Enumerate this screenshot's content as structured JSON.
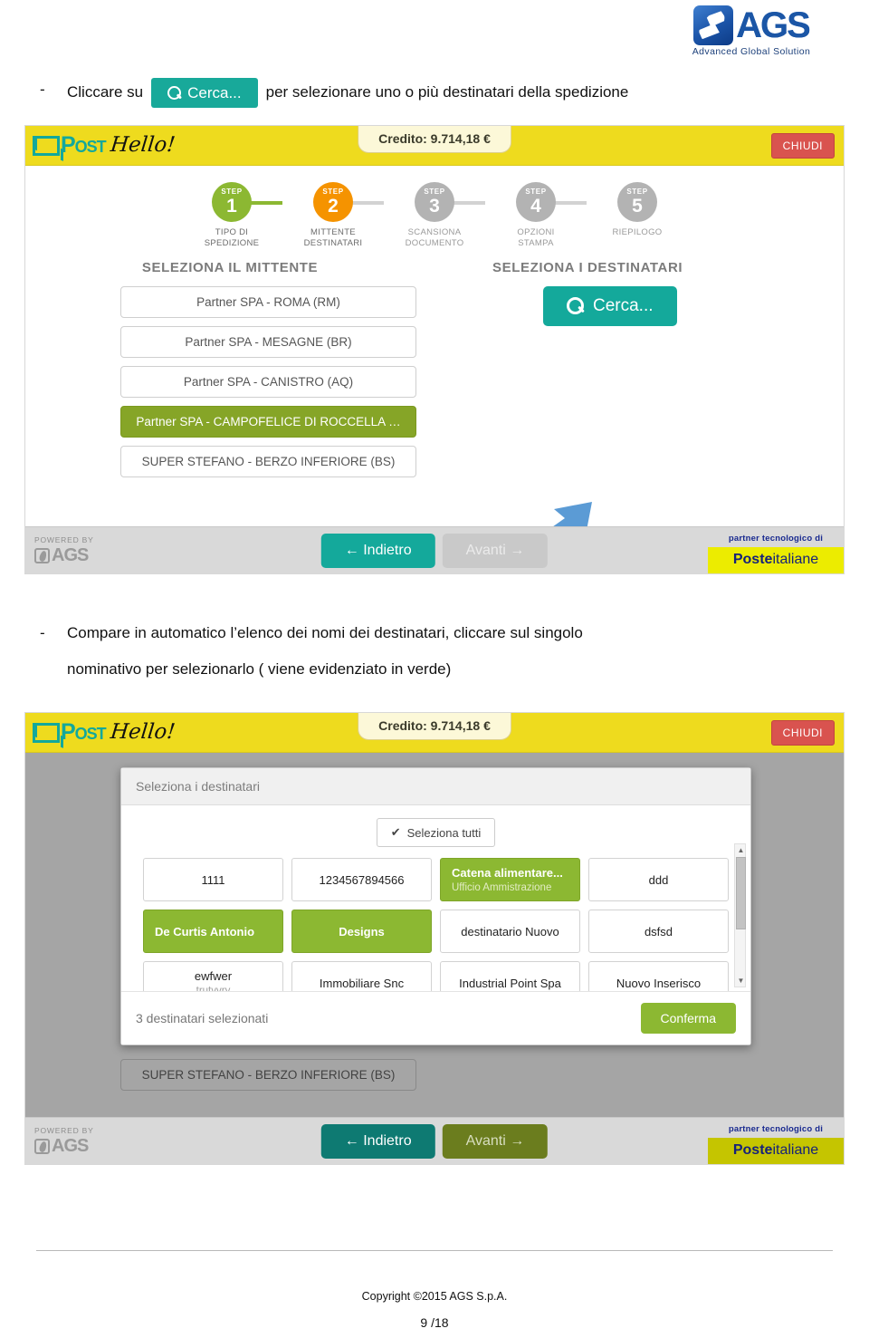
{
  "brand": {
    "ags_name": "AGS",
    "ags_tagline": "Advanced Global Solution"
  },
  "instructions": {
    "line1_bullet": "-",
    "line1_before": "Cliccare su",
    "line1_chip": "Cerca...",
    "line1_after": "per selezionare uno o più destinatari della spedizione",
    "line2_bullet": "-",
    "line2_a": "Compare in automatico l’elenco dei nomi dei destinatari, cliccare sul singolo",
    "line2_b": "nominativo per selezionarlo ( viene evidenziato in verde)"
  },
  "app": {
    "logo_post": "Post",
    "logo_hello": "Hello!",
    "credito": "Credito: 9.714,18 €",
    "chiudi": "CHIUDI",
    "steps": [
      {
        "word": "STEP",
        "num": "1",
        "label": "TIPO DI\nSPEDIZIONE",
        "label_l1": "TIPO DI",
        "label_l2": "SPEDIZIONE",
        "state": "done"
      },
      {
        "word": "STEP",
        "num": "2",
        "label_l1": "MITTENTE",
        "label_l2": "DESTINATARI",
        "state": "active"
      },
      {
        "word": "STEP",
        "num": "3",
        "label_l1": "SCANSIONA",
        "label_l2": "DOCUMENTO",
        "state": "todo"
      },
      {
        "word": "STEP",
        "num": "4",
        "label_l1": "OPZIONI",
        "label_l2": "STAMPA",
        "state": "todo"
      },
      {
        "word": "STEP",
        "num": "5",
        "label_l1": "RIEPILOGO",
        "label_l2": "",
        "state": "todo"
      }
    ],
    "sender_heading": "SELEZIONA IL MITTENTE",
    "senders": [
      {
        "label": "Partner SPA - ROMA (RM)",
        "selected": false
      },
      {
        "label": "Partner SPA - MESAGNE (BR)",
        "selected": false
      },
      {
        "label": "Partner SPA - CANISTRO (AQ)",
        "selected": false
      },
      {
        "label": "Partner SPA - CAMPOFELICE DI ROCCELLA …",
        "selected": true
      },
      {
        "label": "SUPER STEFANO - BERZO INFERIORE (BS)",
        "selected": false
      }
    ],
    "recipient_heading": "SELEZIONA I DESTINATARI",
    "cerca_button": "Cerca...",
    "footer": {
      "powered_by": "POWERED BY",
      "powered_logo": "AGS",
      "back": "← Indietro",
      "next": "Avanti →",
      "partner_label": "partner tecnologico di",
      "poste_bold": "Poste",
      "poste_rest": "italiane"
    }
  },
  "modal": {
    "title": "Seleziona i destinatari",
    "select_all": "Seleziona tutti",
    "select_all_check": "✔",
    "recipients": [
      {
        "name": "1111",
        "sub": "",
        "selected": false
      },
      {
        "name": "1234567894566",
        "sub": "",
        "selected": false
      },
      {
        "name": "Catena alimentare...",
        "sub": "Ufficio Ammistrazione",
        "selected": true
      },
      {
        "name": "ddd",
        "sub": "",
        "selected": false
      },
      {
        "name": "De Curtis Antonio",
        "sub": "",
        "selected": true
      },
      {
        "name": "Designs",
        "sub": "",
        "selected": true
      },
      {
        "name": "destinatario Nuovo",
        "sub": "",
        "selected": false
      },
      {
        "name": "dsfsd",
        "sub": "",
        "selected": false
      },
      {
        "name": "ewfwer",
        "sub": "trutvvry",
        "selected": false
      },
      {
        "name": "Immobiliare Snc",
        "sub": "",
        "selected": false
      },
      {
        "name": "Industrial Point Spa",
        "sub": "",
        "selected": false
      },
      {
        "name": "Nuovo Inserisco",
        "sub": "",
        "selected": false
      }
    ],
    "selected_count_text": "3 destinatari selezionati",
    "confirm": "Conferma",
    "scroll_up": "▲",
    "scroll_down": "▼"
  },
  "page": {
    "copyright": "Copyright ©2015 AGS S.p.A.",
    "number": "9 /18"
  },
  "colors": {
    "teal": "#14a99b",
    "green": "#8cb832",
    "orange": "#f59300",
    "yellow_header": "#eedb1e",
    "red": "#d9534f",
    "arrow_blue": "#5b9bd5"
  }
}
